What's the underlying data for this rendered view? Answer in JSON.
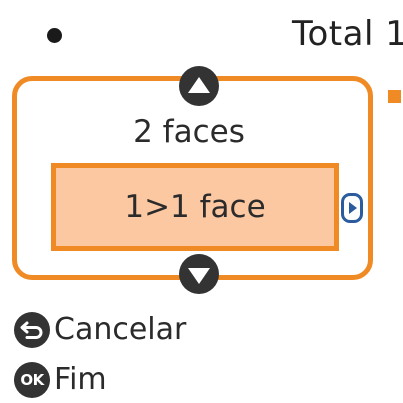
{
  "status": {
    "indicator_icon": "dot-indicator-icon",
    "total_text": "Total 1"
  },
  "selector": {
    "options": [
      "2 faces",
      "1>1 face"
    ],
    "selected_index": 1,
    "up_icon": "triangle-up-icon",
    "down_icon": "triangle-down-icon",
    "detail_icon": "triangle-right-icon"
  },
  "legend": {
    "cancel_label": "Cancelar",
    "cancel_icon": "back-arrow-icon",
    "done_icon_text": "OK",
    "done_label": "Fim"
  },
  "colors": {
    "accent": "#f08a24",
    "selected_fill": "#fbc8a2",
    "icon_dark": "#333333",
    "detail_blue": "#2b5c9e"
  }
}
